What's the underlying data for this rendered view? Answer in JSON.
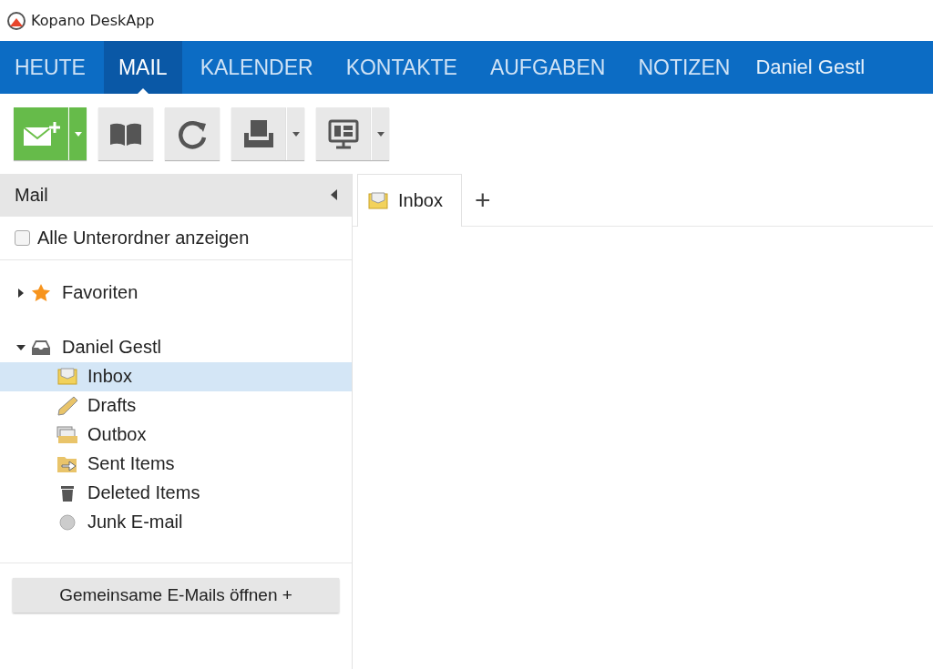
{
  "window": {
    "title": "Kopano DeskApp"
  },
  "nav": {
    "tabs": [
      {
        "label": "HEUTE",
        "selected": false
      },
      {
        "label": "MAIL",
        "selected": true
      },
      {
        "label": "KALENDER",
        "selected": false
      },
      {
        "label": "KONTAKTE",
        "selected": false
      },
      {
        "label": "AUFGABEN",
        "selected": false
      },
      {
        "label": "NOTIZEN",
        "selected": false
      }
    ],
    "user": "Daniel Gestl"
  },
  "toolbar": [
    {
      "kind": "new-mail",
      "dropdown": true
    },
    {
      "kind": "address-book",
      "dropdown": false
    },
    {
      "kind": "refresh",
      "dropdown": false
    },
    {
      "kind": "print",
      "dropdown": true
    },
    {
      "kind": "view",
      "dropdown": true
    }
  ],
  "sidebar": {
    "title": "Mail",
    "show_all_subfolders": {
      "label": "Alle Unterordner anzeigen",
      "checked": false
    },
    "tree": [
      {
        "label": "Favoriten",
        "kind": "favorites",
        "expanded": false
      },
      {
        "label": "Daniel Gestl",
        "kind": "store",
        "expanded": true,
        "children": [
          {
            "label": "Inbox",
            "kind": "inbox",
            "selected": true
          },
          {
            "label": "Drafts",
            "kind": "drafts",
            "selected": false
          },
          {
            "label": "Outbox",
            "kind": "outbox",
            "selected": false
          },
          {
            "label": "Sent Items",
            "kind": "sent",
            "selected": false
          },
          {
            "label": "Deleted Items",
            "kind": "deleted",
            "selected": false
          },
          {
            "label": "Junk E-mail",
            "kind": "junk",
            "selected": false
          }
        ]
      }
    ],
    "open_shared_button": "Gemeinsame E-Mails öffnen +"
  },
  "content_tabs": [
    {
      "label": "Inbox",
      "selected": true
    }
  ],
  "add_tab": "+"
}
